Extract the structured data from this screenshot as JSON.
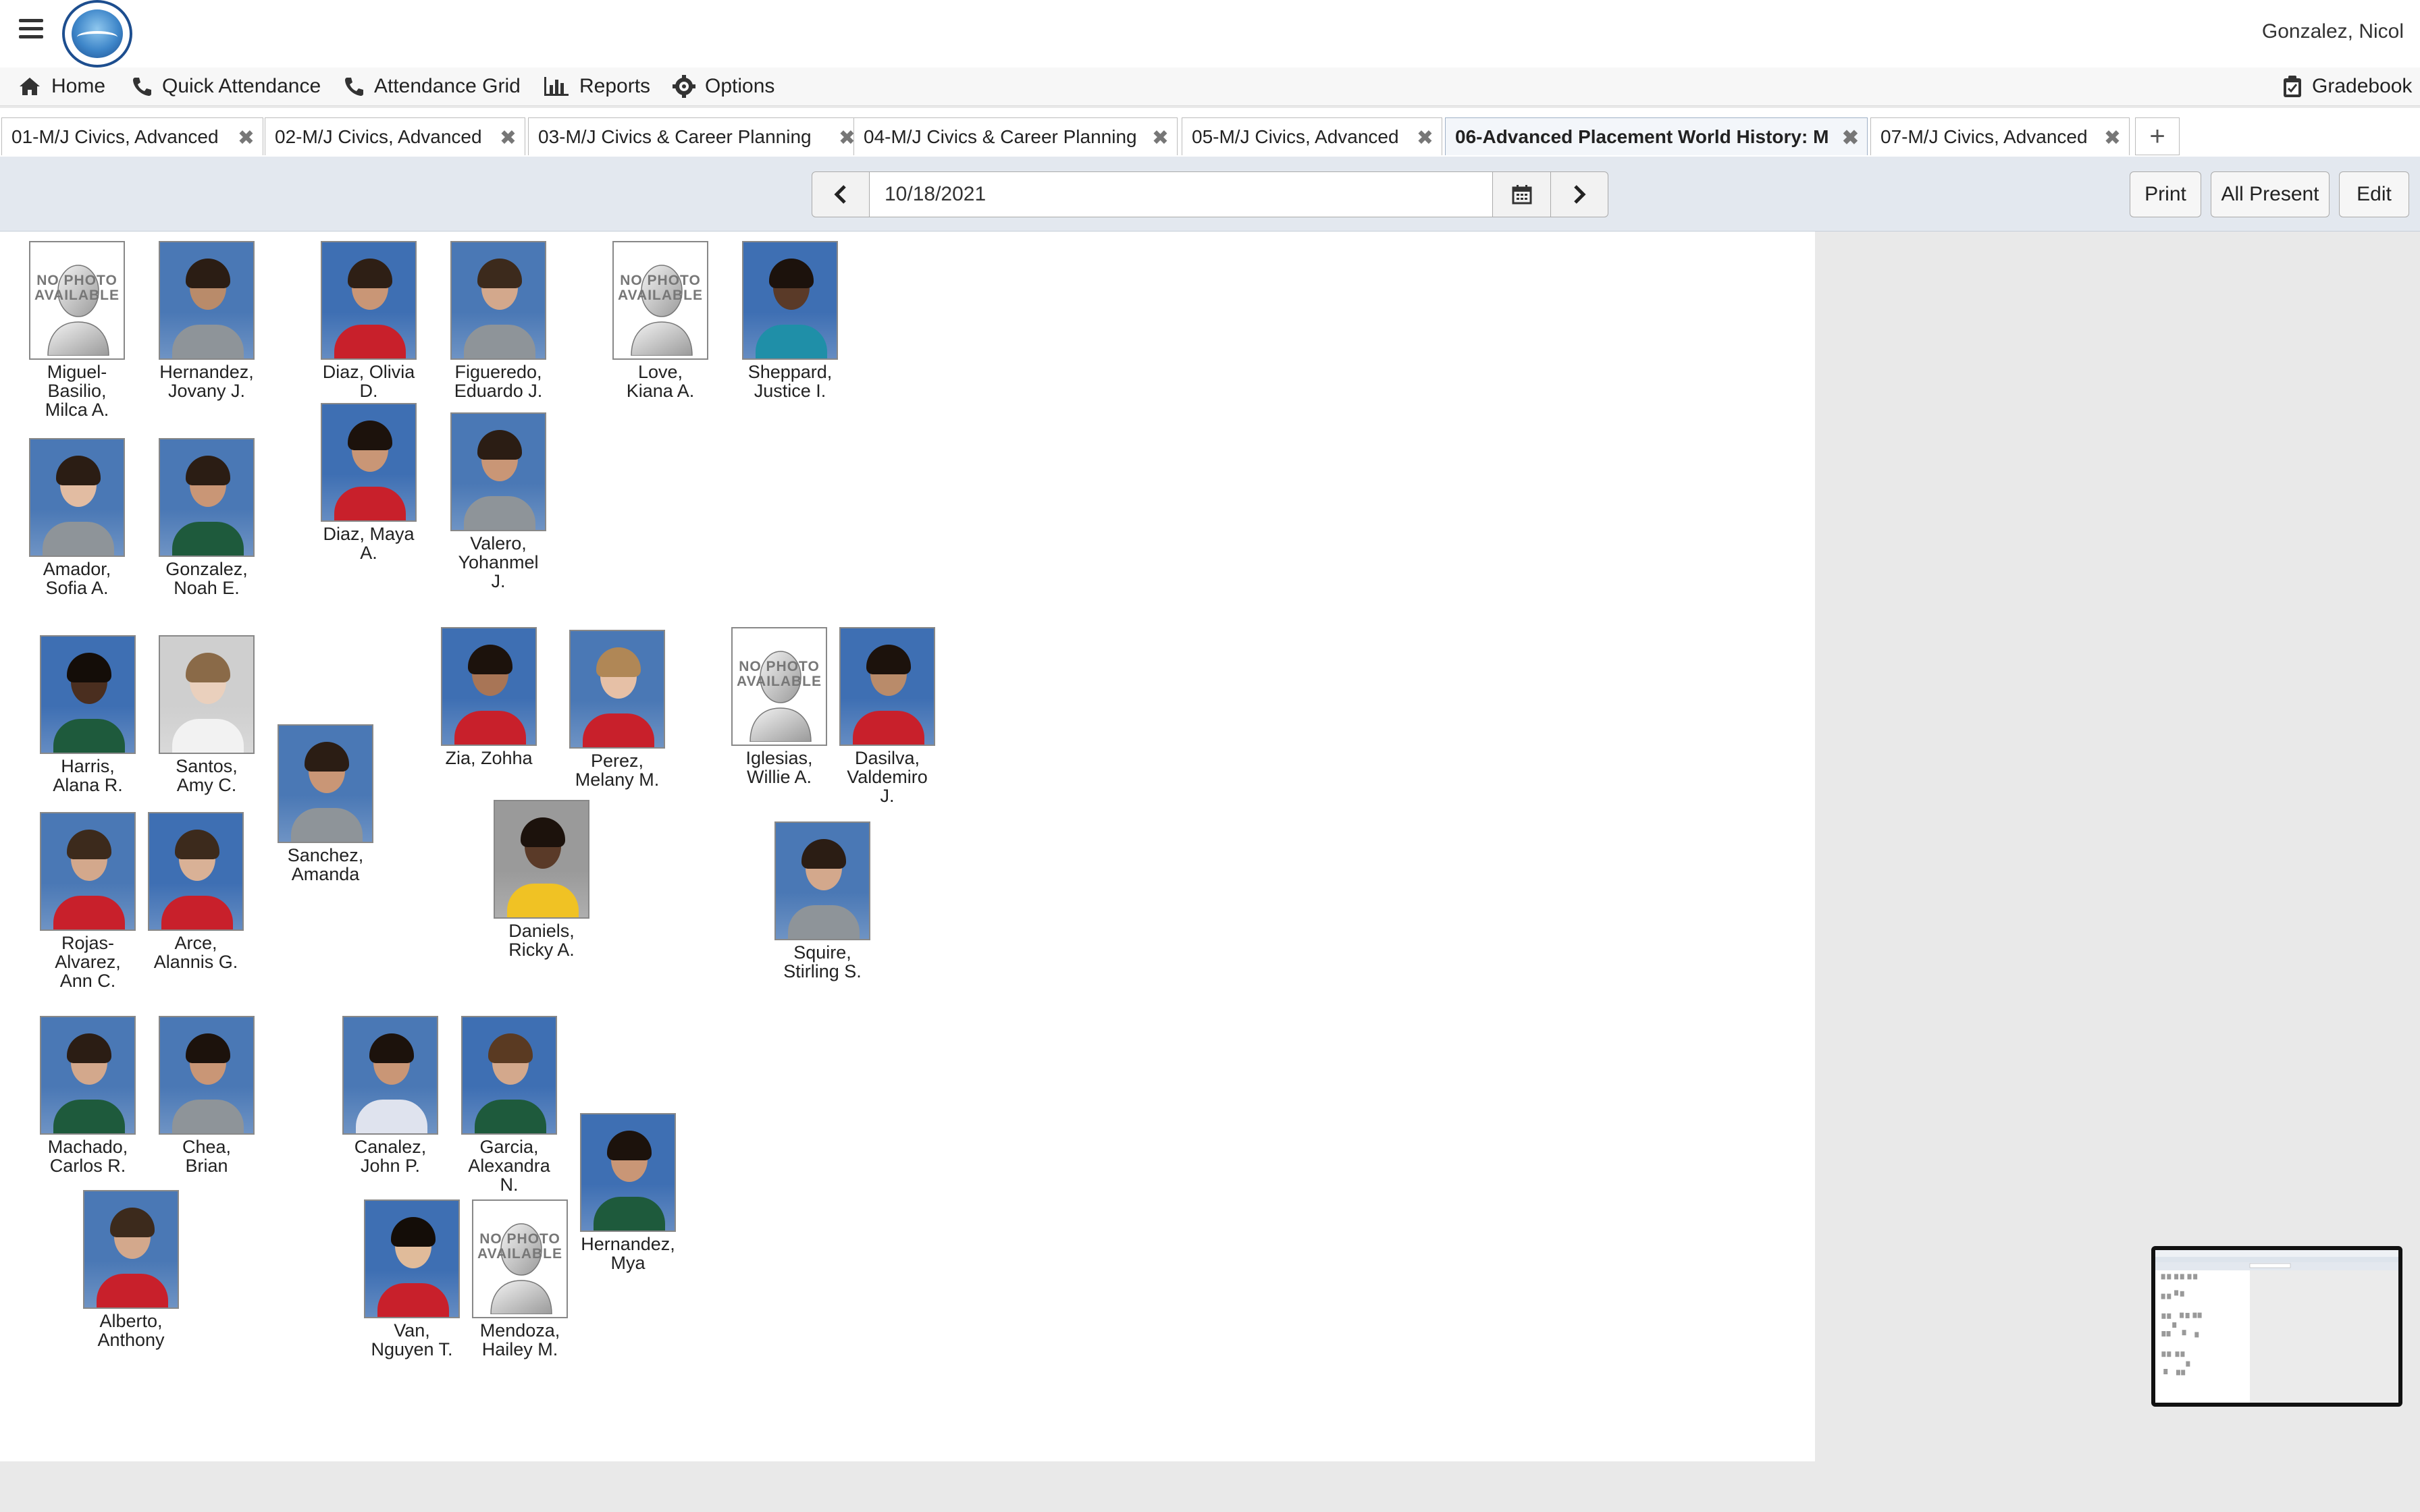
{
  "header": {
    "user": "Gonzalez, Nicol"
  },
  "menu": {
    "home": "Home",
    "quick_attendance": "Quick Attendance",
    "attendance_grid": "Attendance Grid",
    "reports": "Reports",
    "options": "Options",
    "gradebook": "Gradebook"
  },
  "tabs": [
    {
      "label": "01-M/J Civics, Advanced",
      "active": false
    },
    {
      "label": "02-M/J Civics, Advanced",
      "active": false
    },
    {
      "label": "03-M/J Civics & Career Planning",
      "active": false
    },
    {
      "label": "04-M/J Civics & Career Planning",
      "active": false
    },
    {
      "label": "05-M/J Civics, Advanced",
      "active": false
    },
    {
      "label": "06-Advanced Placement World History: M",
      "active": true
    },
    {
      "label": "07-M/J Civics, Advanced",
      "active": false
    }
  ],
  "toolbar": {
    "date": "10/18/2021",
    "print": "Print",
    "all_present": "All Present",
    "edit": "Edit"
  },
  "no_photo_text": "NO\nPHOTO\nAVAILABLE",
  "students": [
    {
      "name": "Miguel-\nBasilio,\nMilca A.",
      "photo": false
    },
    {
      "name": "Hernandez,\nJovany J.",
      "photo": true,
      "shirt": "#8e9499",
      "skin": "#b98b6a",
      "hair": "#2b1d14",
      "bg": "#4a78b5"
    },
    {
      "name": "Diaz, Olivia\nD.",
      "photo": true,
      "shirt": "#c8202b",
      "skin": "#c99676",
      "hair": "#2e1f15",
      "bg": "#3e6fb3"
    },
    {
      "name": "Figueredo,\nEduardo J.",
      "photo": true,
      "shirt": "#8e9499",
      "skin": "#d3a88c",
      "hair": "#3c2a1c",
      "bg": "#4a78b5"
    },
    {
      "name": "Love,\nKiana A.",
      "photo": false
    },
    {
      "name": "Sheppard,\nJustice I.",
      "photo": true,
      "shirt": "#1f8fa8",
      "skin": "#5a3a28",
      "hair": "#1c120c",
      "bg": "#3e6fb3"
    },
    {
      "name": "Amador,\nSofia A.",
      "photo": true,
      "shirt": "#8e9499",
      "skin": "#e2bca2",
      "hair": "#2b1d14",
      "bg": "#4a78b5"
    },
    {
      "name": "Gonzalez,\nNoah E.",
      "photo": true,
      "shirt": "#1e5a3c",
      "skin": "#c99676",
      "hair": "#2b1d14",
      "bg": "#4a78b5"
    },
    {
      "name": "Diaz, Maya\nA.",
      "photo": true,
      "shirt": "#c8202b",
      "skin": "#c99676",
      "hair": "#1c120c",
      "bg": "#3e6fb3"
    },
    {
      "name": "Valero,\nYohanmel\nJ.",
      "photo": true,
      "shirt": "#8e9499",
      "skin": "#c99676",
      "hair": "#2b1d14",
      "bg": "#4a78b5"
    },
    {
      "name": "Harris,\nAlana R.",
      "photo": true,
      "shirt": "#1e5a3c",
      "skin": "#4a2e1f",
      "hair": "#140d08",
      "bg": "#3e6fb3"
    },
    {
      "name": "Santos,\nAmy C.",
      "photo": true,
      "shirt": "#f2f2f2",
      "skin": "#ead0bd",
      "hair": "#8a6a48",
      "bg": "#cfcfcf"
    },
    {
      "name": "Sanchez,\nAmanda",
      "photo": true,
      "shirt": "#8e9499",
      "skin": "#c99676",
      "hair": "#2b1d14",
      "bg": "#4a78b5"
    },
    {
      "name": "Zia, Zohha",
      "photo": true,
      "shirt": "#c8202b",
      "skin": "#a87556",
      "hair": "#1c120c",
      "bg": "#3e6fb3"
    },
    {
      "name": "Perez,\nMelany M.",
      "photo": true,
      "shirt": "#c8202b",
      "skin": "#e6c0a6",
      "hair": "#b08756",
      "bg": "#4a78b5"
    },
    {
      "name": "Iglesias,\nWillie A.",
      "photo": false
    },
    {
      "name": "Dasilva,\nValdemiro\nJ.",
      "photo": true,
      "shirt": "#c8202b",
      "skin": "#b98b6a",
      "hair": "#1c120c",
      "bg": "#3e6fb3"
    },
    {
      "name": "Rojas-\nAlvarez,\nAnn C.",
      "photo": true,
      "shirt": "#c8202b",
      "skin": "#d3a88c",
      "hair": "#3c2a1c",
      "bg": "#4a78b5"
    },
    {
      "name": "Arce,\nAlannis G.",
      "photo": true,
      "shirt": "#c8202b",
      "skin": "#d9b196",
      "hair": "#3c2a1c",
      "bg": "#3e6fb3"
    },
    {
      "name": "Daniels,\nRicky A.",
      "photo": true,
      "shirt": "#f0c224",
      "skin": "#5a3a28",
      "hair": "#1c120c",
      "bg": "#9a9a9a"
    },
    {
      "name": "Squire,\nStirling S.",
      "photo": true,
      "shirt": "#8e9499",
      "skin": "#d3a88c",
      "hair": "#2b1d14",
      "bg": "#4a78b5"
    },
    {
      "name": "Machado,\nCarlos R.",
      "photo": true,
      "shirt": "#1e5a3c",
      "skin": "#d3a88c",
      "hair": "#2b1d14",
      "bg": "#4a78b5"
    },
    {
      "name": "Chea,\nBrian",
      "photo": true,
      "shirt": "#8e9499",
      "skin": "#c99676",
      "hair": "#1c120c",
      "bg": "#4a78b5"
    },
    {
      "name": "Canalez,\nJohn P.",
      "photo": true,
      "shirt": "#dfe3ee",
      "skin": "#c99676",
      "hair": "#1c120c",
      "bg": "#4a78b5"
    },
    {
      "name": "Garcia,\nAlexandra\nN.",
      "photo": true,
      "shirt": "#1e5a3c",
      "skin": "#d3a88c",
      "hair": "#5a3a22",
      "bg": "#3e6fb3"
    },
    {
      "name": "Hernandez,\nMya",
      "photo": true,
      "shirt": "#1e5a3c",
      "skin": "#c99676",
      "hair": "#1c120c",
      "bg": "#3e6fb3"
    },
    {
      "name": "Alberto,\nAnthony",
      "photo": true,
      "shirt": "#c8202b",
      "skin": "#d3a88c",
      "hair": "#3c2a1c",
      "bg": "#4a78b5"
    },
    {
      "name": "Van,\nNguyen T.",
      "photo": true,
      "shirt": "#c8202b",
      "skin": "#e0bb9a",
      "hair": "#140d08",
      "bg": "#3e6fb3"
    },
    {
      "name": "Mendoza,\nHailey M.",
      "photo": false
    }
  ]
}
